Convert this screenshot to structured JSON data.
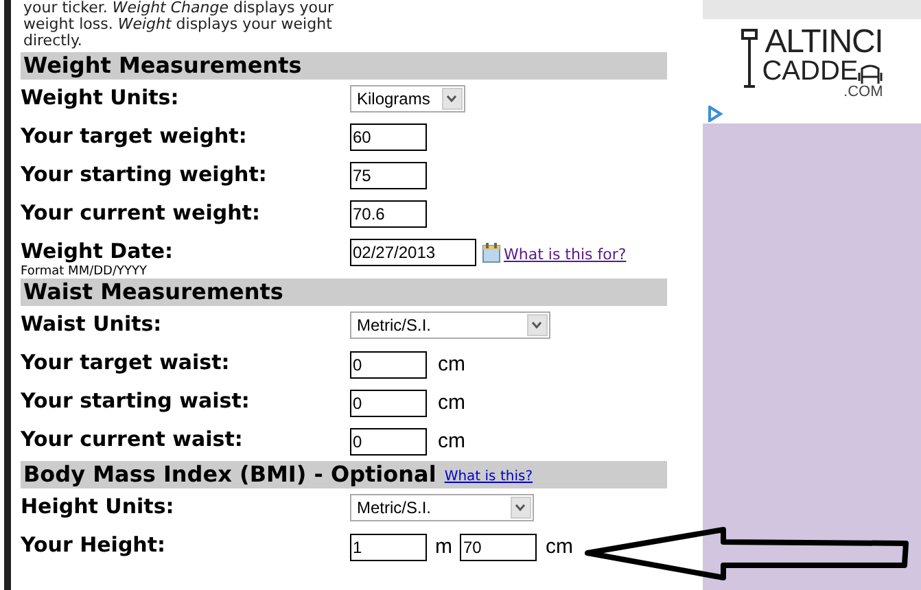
{
  "intro": "your ticker. *Weight Change* displays your weight loss. *Weight* displays your weight directly.",
  "sections": [
    {
      "title": "Weight Measurements",
      "rows": [
        {
          "kind": "select",
          "label": "Weight Units:",
          "value": "Kilograms"
        },
        {
          "kind": "input",
          "label": "Your target weight:",
          "value": "60"
        },
        {
          "kind": "input",
          "label": "Your starting weight:",
          "value": "75"
        },
        {
          "kind": "input",
          "label": "Your current weight:",
          "value": "70.6"
        },
        {
          "kind": "date",
          "label": "Weight Date:",
          "hint": "Format MM/DD/YYYY",
          "value": "02/27/2013",
          "link": "What is this for?"
        }
      ]
    },
    {
      "title": "Waist Measurements",
      "rows": [
        {
          "kind": "select",
          "label": "Waist Units:",
          "value": "Metric/S.I."
        },
        {
          "kind": "input",
          "label": "Your target waist:",
          "value": "0",
          "unit": "cm"
        },
        {
          "kind": "input",
          "label": "Your starting waist:",
          "value": "0",
          "unit": "cm"
        },
        {
          "kind": "input",
          "label": "Your current waist:",
          "value": "0",
          "unit": "cm"
        }
      ]
    },
    {
      "title": "Body Mass Index (BMI) - Optional",
      "link": "What is this?",
      "rows": [
        {
          "kind": "select",
          "label": "Height Units:",
          "value": "Metric/S.I."
        },
        {
          "kind": "height",
          "label": "Your Height:",
          "fields": [
            {
              "value": "1",
              "unit": "m"
            },
            {
              "value": "70",
              "unit": "cm"
            }
          ]
        }
      ]
    }
  ],
  "ad": {
    "logo_top": "ALTINCI",
    "logo_bottom": "CADDE",
    "logo_suffix": ".COM"
  }
}
